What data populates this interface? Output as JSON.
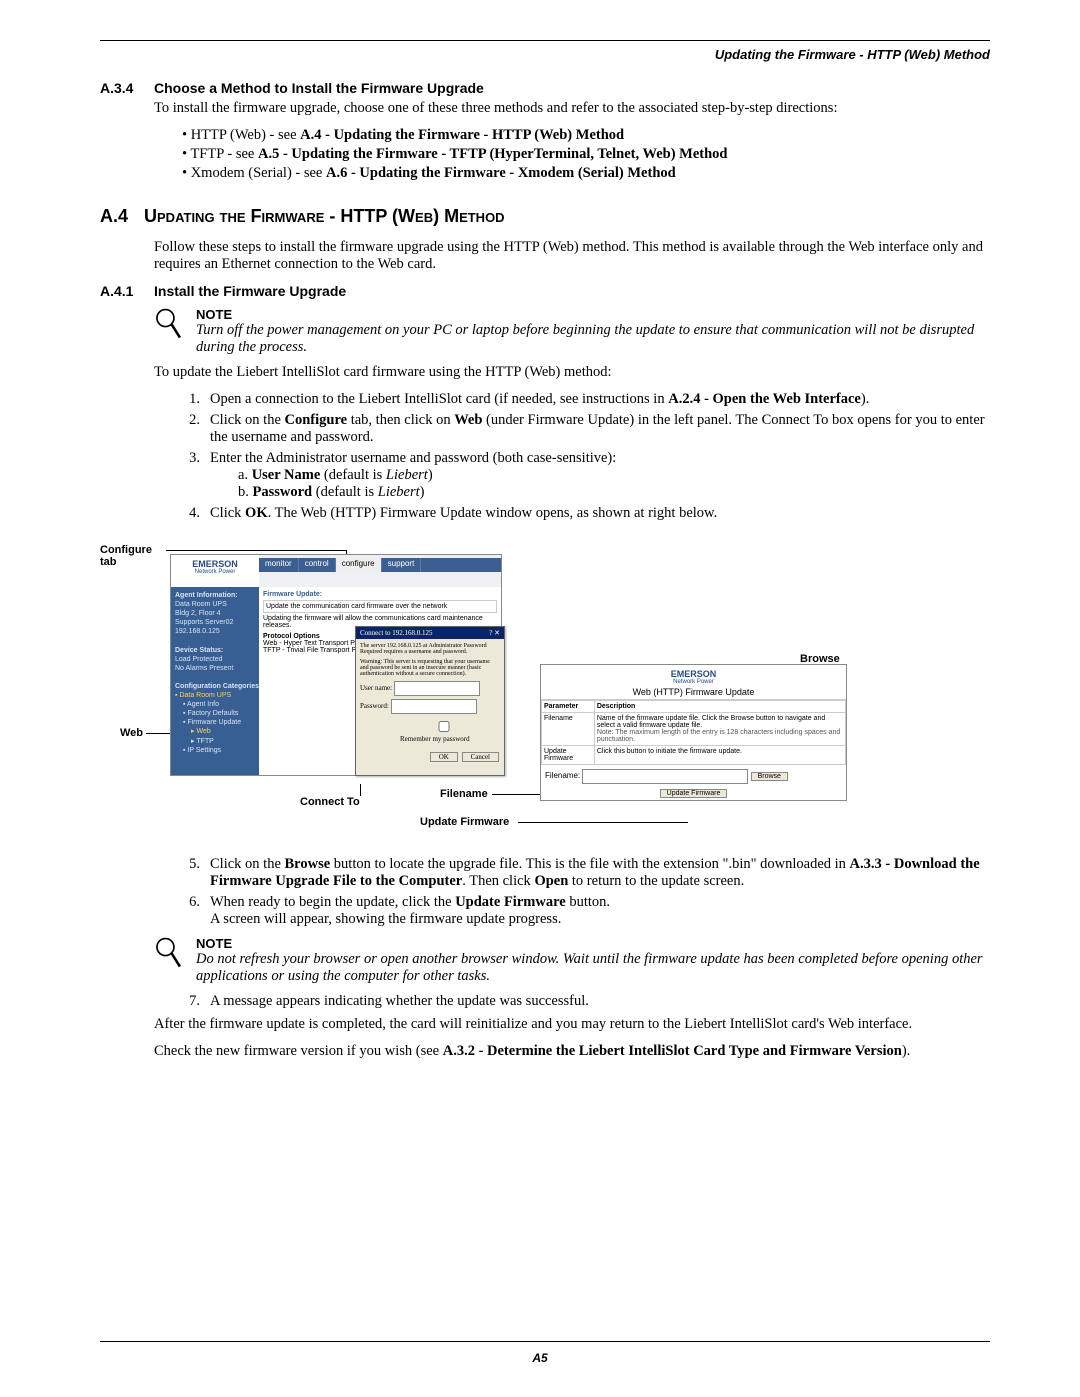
{
  "header": {
    "running": "Updating the Firmware - HTTP (Web) Method"
  },
  "s1": {
    "num": "A.3.4",
    "title": "Choose a Method to Install the Firmware Upgrade",
    "intro": "To install the firmware upgrade, choose one of these three methods and refer to the associated step-by-step directions:",
    "b1a": "HTTP (Web) - see ",
    "b1b": "A.4 - Updating the Firmware - HTTP (Web) Method",
    "b2a": "TFTP - see ",
    "b2b": "A.5 - Updating the Firmware - TFTP (HyperTerminal, Telnet, Web) Method",
    "b3a": "Xmodem (Serial) - see ",
    "b3b": "A.6 - Updating the Firmware - Xmodem (Serial) Method"
  },
  "s2": {
    "num": "A.4",
    "title": "Updating the Firmware - HTTP (Web) Method",
    "intro": "Follow these steps to install the firmware upgrade using the HTTP (Web) method. This method is available through the Web interface only and requires an Ethernet connection to the Web card."
  },
  "s3": {
    "num": "A.4.1",
    "title": "Install the Firmware Upgrade",
    "note_lbl": "NOTE",
    "note1": "Turn off the power management on your PC or laptop before beginning the update to ensure that communication will not be disrupted during the process.",
    "p1": "To update the Liebert IntelliSlot card firmware using the HTTP (Web) method:",
    "li1a": "Open a connection to the Liebert IntelliSlot card (if needed, see instructions in ",
    "li1b": "A.2.4 - Open the Web Interface",
    "li1c": ").",
    "li2a": "Click on the ",
    "li2b": "Configure",
    "li2c": " tab, then click on ",
    "li2d": "Web",
    "li2e": " (under Firmware Update) in the left panel. The Connect To box opens for you to enter the username and password.",
    "li3": "Enter the Administrator username and password (both case-sensitive):",
    "li3a1": "a.",
    "li3a2": "User Name",
    "li3a3": " (default is ",
    "li3a4": "Liebert",
    "li3a5": ")",
    "li3b1": "b.",
    "li3b2": "Password",
    "li3b3": " (default is ",
    "li3b4": "Liebert",
    "li3b5": ")",
    "li4a": "Click ",
    "li4b": "OK",
    "li4c": ". The Web (HTTP) Firmware Update window opens, as shown at right below."
  },
  "diagram": {
    "cfg_tab": "Configure tab",
    "web": "Web",
    "connect": "Connect To",
    "browse": "Browse",
    "filename": "Filename",
    "updatefw": "Update Firmware",
    "brand": "EMERSON",
    "brand_sub": "Network Power",
    "tabs": {
      "m": "monitor",
      "c": "control",
      "cf": "configure",
      "s": "support"
    },
    "fw_hdr": "Firmware Update:",
    "fw_desc": "Update the communication card firmware over the network",
    "fw_warn": "Updating the firmware will allow the communications card maintenance releases.",
    "proto_hdr": "Protocol Options",
    "proto1": "Web - Hyper Text Transport Protocol (",
    "proto2": "TFTP - Trivial File Transport Protocol",
    "side_ai": "Agent Information:",
    "side_l1": "Data Room UPS",
    "side_l2": "Bldg 2, Floor 4",
    "side_l3": "Supports Server02",
    "side_l4": "192.168.0.125",
    "side_ds": "Device Status:",
    "side_ds1": "Load Protected",
    "side_ds2": "No Alarms Present",
    "side_cc": "Configuration Categories:",
    "side_cc1": "Data Room UPS",
    "side_cc2": "Agent Info",
    "side_cc3": "Factory Defaults",
    "side_cc4": "Firmware Update",
    "side_cc5": "Web",
    "side_cc6": "TFTP",
    "side_cc7": "IP Settings",
    "conn_title": "Connect to 192.168.0.125",
    "conn_msg1": "The server 192.168.0.125 at Administrator Password Required requires a username and password.",
    "conn_msg2": "Warning: This server is requesting that your username and password be sent in an insecure manner (basic authentication without a secure connection).",
    "conn_user": "User name:",
    "conn_pass": "Password:",
    "conn_remember": "Remember my password",
    "conn_ok": "OK",
    "conn_cancel": "Cancel",
    "right_title": "Web (HTTP) Firmware Update",
    "th1": "Parameter",
    "th2": "Description",
    "r1a": "Filename",
    "r1b": "Name of the firmware update file. Click the Browse button to navigate and select a valid firmware update file.",
    "r1n": "Note: The maximum length of the entry is 128 characters including spaces and punctuation.",
    "r2a": "Update Firmware",
    "r2b": "Click this button to initiate the firmware update.",
    "fn_lbl": "Filename:",
    "browse_btn": "Browse",
    "update_btn": "Update Firmware"
  },
  "s4": {
    "li5a": "Click on the ",
    "li5b": "Browse",
    "li5c": " button to locate the upgrade file. This is the file with the extension \".bin\" downloaded in ",
    "li5d": "A.3.3 - Download the Firmware Upgrade File to the Computer",
    "li5e": ". Then click ",
    "li5f": "Open",
    "li5g": " to return to the update screen.",
    "li6a": "When ready to begin the update, click the ",
    "li6b": "Update Firmware",
    "li6c": " button.",
    "li6d": "A screen will appear, showing the firmware update progress.",
    "note_lbl": "NOTE",
    "note2": "Do not refresh your browser or open another browser window. Wait until the firmware update has been completed before opening other applications or using the computer for other tasks.",
    "li7": "A message appears indicating whether the update was successful.",
    "p_after": "After the firmware update is completed, the card will reinitialize and you may return to the Liebert IntelliSlot card's Web interface.",
    "p_check_a": "Check the new firmware version if you wish (see ",
    "p_check_b": "A.3.2 - Determine the Liebert IntelliSlot Card Type and Firmware Version",
    "p_check_c": ")."
  },
  "footer": {
    "page": "A5"
  }
}
